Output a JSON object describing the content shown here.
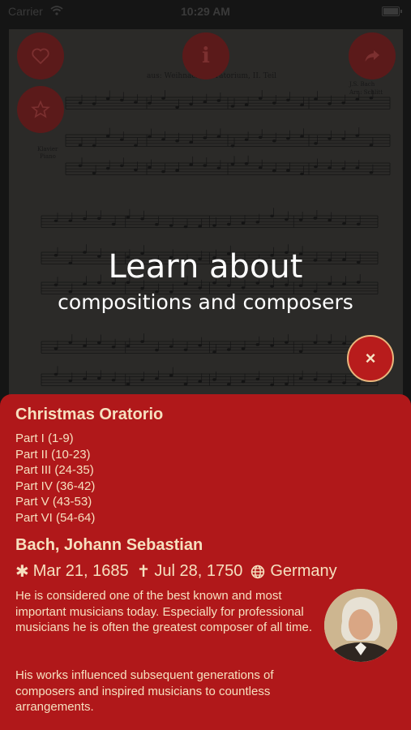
{
  "status_bar": {
    "carrier": "Carrier",
    "time": "10:29 AM"
  },
  "sheet": {
    "heading": "aus: Weihnachts-Oratorium, II. Teil",
    "composer_mark": "J.S. Bach",
    "arranger_mark": "Arr.: Schlitt",
    "instrument_label_1": "Klavier",
    "instrument_label_2": "Piano"
  },
  "toolbar": {
    "favorite_icon": "heart-icon",
    "bookmark_icon": "star-icon",
    "info_glyph": "i",
    "share_icon": "share-arrow-icon"
  },
  "overlay": {
    "title": "Learn about",
    "subtitle": "compositions and composers",
    "close_glyph": "×"
  },
  "composition": {
    "title": "Christmas Oratorio",
    "parts": [
      "Part I (1-9)",
      "Part II (10-23)",
      "Part III (24-35)",
      "Part IV (36-42)",
      "Part V (43-53)",
      "Part VI (54-64)"
    ]
  },
  "composer": {
    "name": "Bach, Johann Sebastian",
    "born_symbol": "✱",
    "born": "Mar 21, 1685",
    "died_symbol": "✝",
    "died": "Jul 28, 1750",
    "country": "Germany",
    "bio_1": "He is considered one of the best known and most important musicians today. Especially for professional musicians he is often the greatest composer of all time.",
    "bio_2": "His works influenced subsequent generations of composers and inspired musicians to countless arrangements."
  },
  "colors": {
    "panel_red": "#b0181a",
    "panel_text": "#f6e0bf",
    "dim_button": "#5b1a1a",
    "close_border": "#e8b77d"
  }
}
